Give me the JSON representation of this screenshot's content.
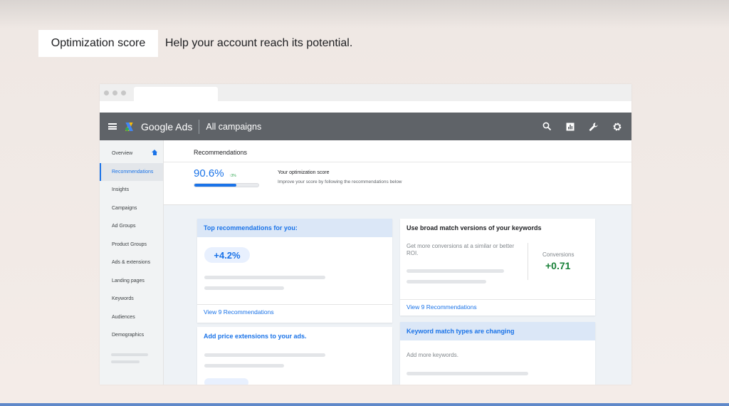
{
  "slide": {
    "title": "Optimization score",
    "subtitle": "Help your account reach its potential."
  },
  "app": {
    "brand": "Google Ads",
    "breadcrumb": "All campaigns",
    "icons": [
      "search-icon",
      "reports-icon",
      "tools-icon",
      "settings-icon"
    ]
  },
  "sidebar": {
    "items": [
      {
        "label": "Overview",
        "active": false
      },
      {
        "label": "Recommendations",
        "active": true
      },
      {
        "label": "Insights",
        "active": false
      },
      {
        "label": "Campaigns",
        "active": false
      },
      {
        "label": "Ad Groups",
        "active": false
      },
      {
        "label": "Product Groups",
        "active": false
      },
      {
        "label": "Ads & extensions",
        "active": false
      },
      {
        "label": "Landing pages",
        "active": false
      },
      {
        "label": "Keywords",
        "active": false
      },
      {
        "label": "Audiences",
        "active": false
      },
      {
        "label": "Demographics",
        "active": false
      }
    ]
  },
  "recommendations": {
    "title": "Recommendations",
    "score": "90.6%",
    "delta": "↑3%",
    "progress_fraction": 0.66,
    "score_label": "Your optimization score",
    "score_desc": "Improve your score by following the recommendations below"
  },
  "cards": {
    "top": {
      "heading": "Top recommendations for you:",
      "uplift": "+4.2%",
      "link": "View 9 Recommendations"
    },
    "broad": {
      "heading": "Use broad match versions of your keywords",
      "body": "Get more conversions at a similar or better ROI.",
      "metric_label": "Conversions",
      "metric_value": "+0.71",
      "link": "View 9 Recommendations"
    },
    "price": {
      "heading": "Add price extensions to your ads."
    },
    "match": {
      "heading": "Keyword match types are changing",
      "body": "Add more keywords."
    }
  },
  "colors": {
    "accent": "#1a73e8",
    "appbar": "#5f6368",
    "positive": "#188038"
  }
}
